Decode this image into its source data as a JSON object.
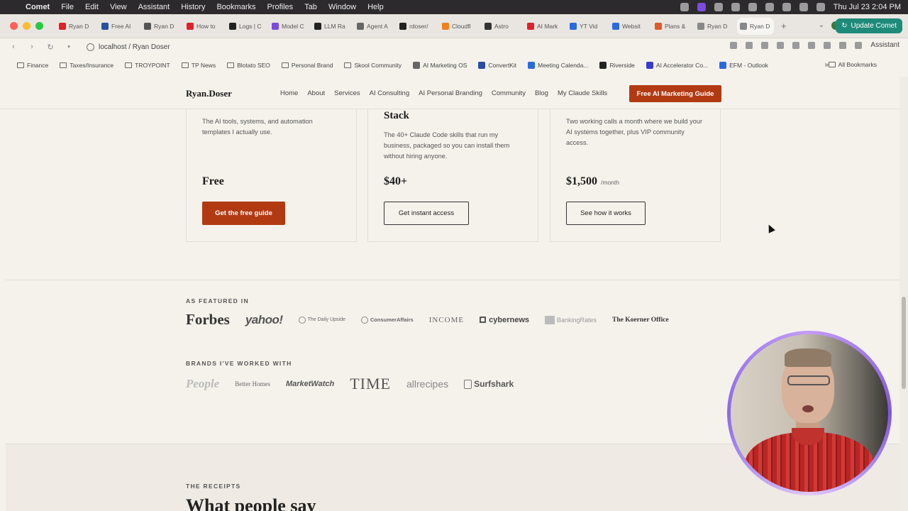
{
  "menubar": {
    "app": "Comet",
    "items": [
      "File",
      "Edit",
      "View",
      "Assistant",
      "History",
      "Bookmarks",
      "Profiles",
      "Tab",
      "Window",
      "Help"
    ],
    "datetime": "Thu Jul 23  2:04 PM"
  },
  "tabs": [
    {
      "label": "Ryan D",
      "color": "#e0202a"
    },
    {
      "label": "Free AI",
      "color": "#2a4fa0"
    },
    {
      "label": "Ryan D",
      "color": "#555555"
    },
    {
      "label": "How to",
      "color": "#e0202a"
    },
    {
      "label": "Logs | C",
      "color": "#222222"
    },
    {
      "label": "Model C",
      "color": "#7a4be0"
    },
    {
      "label": "LLM Ra",
      "color": "#222222"
    },
    {
      "label": "Agent A",
      "color": "#666666"
    },
    {
      "label": "rdoser/",
      "color": "#222222"
    },
    {
      "label": "Cloudfl",
      "color": "#f38020"
    },
    {
      "label": "Astro",
      "color": "#333333"
    },
    {
      "label": "AI Mark",
      "color": "#e0202a"
    },
    {
      "label": "YT Vid",
      "color": "#2a6ae0"
    },
    {
      "label": "Websit",
      "color": "#2a6ae0"
    },
    {
      "label": "Plans &",
      "color": "#e05a2a"
    },
    {
      "label": "Ryan D",
      "color": "#888888"
    },
    {
      "label": "Ryan D",
      "color": "#888888",
      "active": true
    }
  ],
  "update_button": "Update Comet",
  "address": {
    "url": "localhost / Ryan Doser",
    "assistant": "Assistant"
  },
  "bookmarks": [
    {
      "label": "Finance",
      "type": "folder"
    },
    {
      "label": "Taxes/Insurance",
      "type": "folder"
    },
    {
      "label": "TROYPOINT",
      "type": "folder"
    },
    {
      "label": "TP News",
      "type": "folder"
    },
    {
      "label": "Blotato SEO",
      "type": "folder"
    },
    {
      "label": "Personal Brand",
      "type": "folder"
    },
    {
      "label": "Skool Community",
      "type": "folder"
    },
    {
      "label": "AI Marketing OS",
      "type": "site",
      "color": "#666666"
    },
    {
      "label": "ConvertKit",
      "type": "site",
      "color": "#2a4fa0"
    },
    {
      "label": "Meeting Calenda...",
      "type": "site",
      "color": "#2a6ae0"
    },
    {
      "label": "Riverside",
      "type": "site",
      "color": "#222222"
    },
    {
      "label": "AI Accelerator Co...",
      "type": "site",
      "color": "#3a3ad0"
    },
    {
      "label": "EFM - Outlook",
      "type": "site",
      "color": "#2a6ae0"
    }
  ],
  "bookmarks_more": "»",
  "bookmarks_all": "All Bookmarks",
  "site": {
    "logo": "Ryan.Doser",
    "nav": [
      "Home",
      "About",
      "Services",
      "AI Consulting",
      "AI Personal Branding",
      "Community",
      "Blog",
      "My Claude Skills"
    ],
    "cta": "Free AI Marketing Guide"
  },
  "cards": [
    {
      "heading": "",
      "desc": "The AI tools, systems, and automation templates I actually use.",
      "price": "Free",
      "per": "",
      "button": "Get the free guide",
      "primary": true
    },
    {
      "heading": "Stack",
      "desc": "The 40+ Claude Code skills that run my business, packaged so you can install them without hiring anyone.",
      "price": "$40+",
      "per": "",
      "button": "Get instant access",
      "primary": false
    },
    {
      "heading": "",
      "desc": "Two working calls a month where we build your AI systems together, plus VIP community access.",
      "price": "$1,500",
      "per": "/month",
      "button": "See how it works",
      "primary": false
    }
  ],
  "featured": {
    "eyebrow": "AS FEATURED IN",
    "logos": [
      "Forbes",
      "yahoo!",
      "The Daily Upside",
      "ConsumerAffairs",
      "INCOME",
      "cybernews",
      "BankingRates",
      "The Koerner Office"
    ]
  },
  "brands": {
    "eyebrow": "BRANDS I'VE WORKED WITH",
    "logos": [
      "People",
      "Better Homes",
      "MarketWatch",
      "TIME",
      "allrecipes",
      "Surfshark"
    ]
  },
  "receipts": {
    "eyebrow": "THE RECEIPTS",
    "title": "What people say"
  },
  "colors": {
    "accent": "#b23a12",
    "page_bg": "#f5f2ec",
    "webcam_ring": "#8a6ae8"
  }
}
